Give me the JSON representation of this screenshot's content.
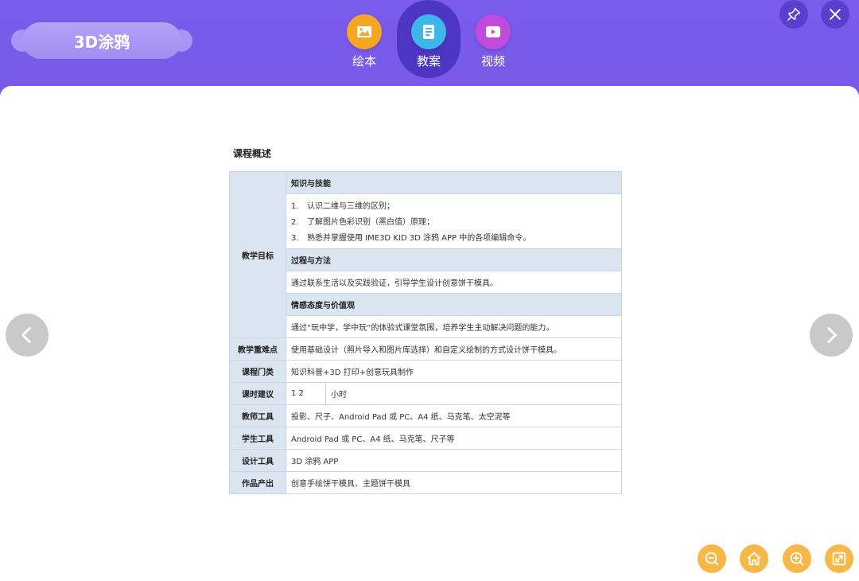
{
  "app": {
    "title": "3D涂鸦"
  },
  "tabs": [
    {
      "label": "绘本",
      "icon": "picture-icon",
      "color": "#f5a623",
      "active": false
    },
    {
      "label": "教案",
      "icon": "document-icon",
      "color": "#3fb6ea",
      "active": true
    },
    {
      "label": "视频",
      "icon": "video-play-icon",
      "color": "#c04bdc",
      "active": false
    }
  ],
  "window": {
    "pin_icon": "pin-icon",
    "close_icon": "close-icon"
  },
  "doc": {
    "heading": "课程概述",
    "objectives": {
      "label": "教学目标",
      "knowledge": {
        "title": "知识与技能",
        "items": [
          {
            "num": "1.",
            "text": "认识二维与三维的区别；"
          },
          {
            "num": "2.",
            "text": "了解图片色彩识别（黑白值）原理；"
          },
          {
            "num": "3.",
            "text": "熟悉并掌握使用 IME3D KID 3D 涂鸦 APP 中的各项编辑命令。"
          }
        ]
      },
      "process": {
        "title": "过程与方法",
        "text": "通过联系生活以及实践验证，引导学生设计创意饼干模具。"
      },
      "attitude": {
        "title": "情感态度与价值观",
        "text": "通过“玩中学，学中玩”的体验式课堂氛围，培养学生主动解决问题的能力。"
      }
    },
    "rows": {
      "key_points": {
        "label": "教学重难点",
        "value": "使用基础设计（照片导入和图片库选择）和自定义绘制的方式设计饼干模具。"
      },
      "category": {
        "label": "课程门类",
        "value": "知识科普+3D 打印+创意玩具制作"
      },
      "hours": {
        "label": "课时建议",
        "value": "1 2",
        "unit": "小时"
      },
      "teacher_tools": {
        "label": "教师工具",
        "value": "投影、尺子、Android Pad  或  PC、A4 纸、马克笔、太空泥等"
      },
      "student_tools": {
        "label": "学生工具",
        "value": "Android Pad  或  PC、A4 纸、马克笔、尺子等"
      },
      "design_tools": {
        "label": "设计工具",
        "value": "3D 涂鸦 APP"
      },
      "output": {
        "label": "作品产出",
        "value": "创意手绘饼干模具、主题饼干模具"
      }
    }
  },
  "nav": {
    "prev_icon": "chevron-left-icon",
    "next_icon": "chevron-right-icon"
  },
  "tools": [
    {
      "name": "zoom-out-button",
      "icon": "zoom-out-icon"
    },
    {
      "name": "home-button",
      "icon": "home-icon"
    },
    {
      "name": "zoom-in-button",
      "icon": "zoom-in-icon"
    },
    {
      "name": "fullscreen-button",
      "icon": "fullscreen-icon"
    }
  ],
  "colors": {
    "header": "#6a4fe0",
    "tool": "#f7b84a",
    "table_head": "#dbe5f1"
  }
}
